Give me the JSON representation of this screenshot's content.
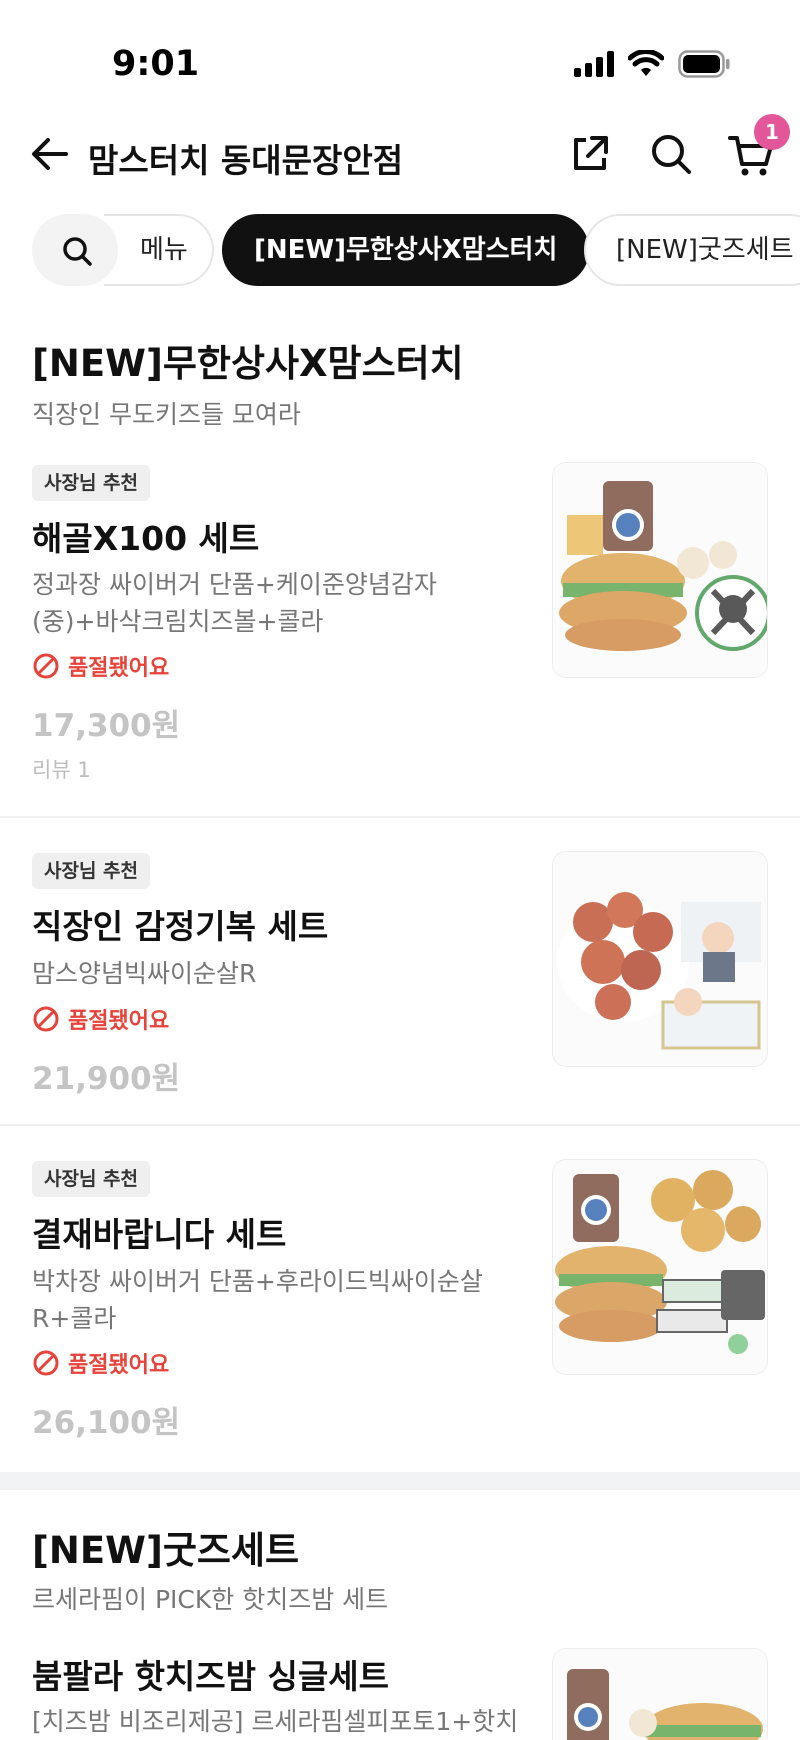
{
  "status_bar": {
    "time": "9:01"
  },
  "header": {
    "title": "맘스터치 동대문장안점",
    "cart_count": "1"
  },
  "tabs": {
    "menu": "메뉴",
    "active": "[NEW]무한상사X맘스터치",
    "goods": "[NEW]굿즈세트"
  },
  "section1": {
    "title": "[NEW]무한상사X맘스터치",
    "subtitle": "직장인 무도키즈들 모여라",
    "items": [
      {
        "badge": "사장님 추천",
        "name": "해골X100 세트",
        "desc": "정과장 싸이버거 단품+케이준양념감자(중)+바삭크림치즈볼+콜라",
        "soldout": "품절됐어요",
        "price": "17,300원",
        "review": "리뷰 1"
      },
      {
        "badge": "사장님 추천",
        "name": "직장인 감정기복 세트",
        "desc": "맘스양념빅싸이순살R",
        "soldout": "품절됐어요",
        "price": "21,900원"
      },
      {
        "badge": "사장님 추천",
        "name": "결재바랍니다 세트",
        "desc": "박차장 싸이버거 단품+후라이드빅싸이순살R+콜라",
        "soldout": "품절됐어요",
        "price": "26,100원"
      }
    ]
  },
  "section2": {
    "title": "[NEW]굿즈세트",
    "subtitle": "르세라핌이 PICK한 핫치즈밤 세트",
    "items": [
      {
        "name": "붐팔라 핫치즈밤 싱글세트",
        "desc": "[치즈밤 비조리제공] 르세라핌셀피포토1+핫치"
      }
    ]
  },
  "icons": {
    "back": "arrow-left-icon",
    "share": "share-icon",
    "search": "search-icon",
    "cart": "cart-icon",
    "soldout": "prohibited-icon"
  },
  "colors": {
    "badge": "#e4569a",
    "soldout": "#e8433b",
    "active_tab": "#111111"
  }
}
